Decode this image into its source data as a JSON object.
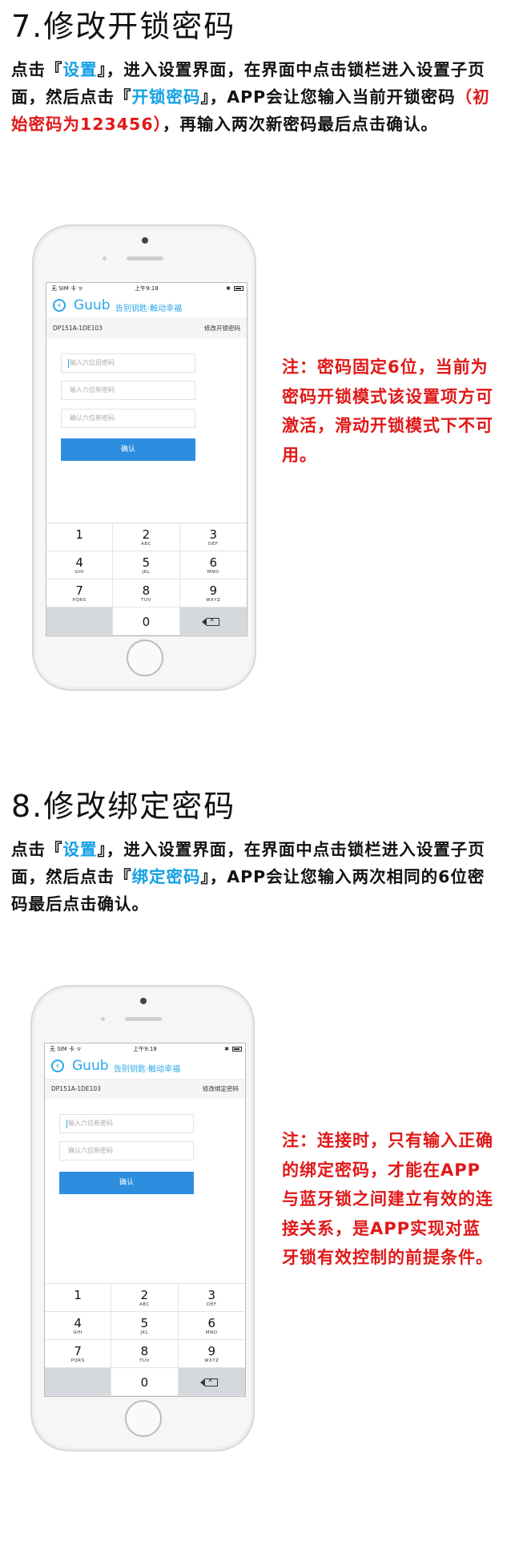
{
  "sections": [
    {
      "title": "7.修改开锁密码",
      "para": {
        "p1": "点击『",
        "p2": "设置",
        "p3": "』，进入设置界面，在界面中点击锁栏进入设置子页面，然后点击『",
        "p4": "开锁密码",
        "p5": "』，APP会让您输入当前开锁密码",
        "p6": "（初始密码为123456）",
        "p7": "，再输入两次新密码最后点击确认。"
      },
      "note": "注：密码固定6位，当前为密码开锁模式该设置项方可激活，滑动开锁模式下不可用。",
      "phone": {
        "status_left": "无 SIM 卡 ᯤ",
        "status_time": "上午9:18",
        "status_bt": "✱",
        "logo": "Guub",
        "slogan": "告别钥匙·触动幸福",
        "device_id": "DP151A-1DE103",
        "page_name": "修改开锁密码",
        "fields": [
          "输入六位旧密码",
          "输入六位新密码",
          "确认六位新密码"
        ],
        "confirm": "确认"
      }
    },
    {
      "title": "8.修改绑定密码",
      "para": {
        "p1": "点击『",
        "p2": "设置",
        "p3": "』，进入设置界面，在界面中点击锁栏进入设置子页面，然后点击『",
        "p4": "绑定密码",
        "p5": "』，APP会让您输入两次相同的6位密码最后点击确认。"
      },
      "note": "注：连接时，只有输入正确的绑定密码，才能在APP与蓝牙锁之间建立有效的连接关系，是APP实现对蓝牙锁有效控制的前提条件。",
      "phone": {
        "status_left": "无 SIM 卡 ᯤ",
        "status_time": "上午9:18",
        "status_bt": "✱",
        "logo": "Guub",
        "slogan": "告别钥匙·触动幸福",
        "device_id": "DP151A-1DE103",
        "page_name": "修改绑定密码",
        "fields": [
          "输入六位新密码",
          "确认六位新密码"
        ],
        "confirm": "确认"
      }
    }
  ],
  "keypad": [
    {
      "n": "1",
      "s": ""
    },
    {
      "n": "2",
      "s": "ABC"
    },
    {
      "n": "3",
      "s": "DEF"
    },
    {
      "n": "4",
      "s": "GHI"
    },
    {
      "n": "5",
      "s": "JKL"
    },
    {
      "n": "6",
      "s": "MNO"
    },
    {
      "n": "7",
      "s": "PQRS"
    },
    {
      "n": "8",
      "s": "TUV"
    },
    {
      "n": "9",
      "s": "WXYZ"
    },
    {
      "n": "0",
      "s": ""
    }
  ],
  "colors": {
    "accent": "#14a0e6",
    "warning": "#e01818",
    "button": "#2d8ee0"
  },
  "icons": {
    "back": "back-arrow-icon",
    "delete": "backspace-icon",
    "battery": "battery-icon",
    "bluetooth": "bluetooth-icon"
  }
}
